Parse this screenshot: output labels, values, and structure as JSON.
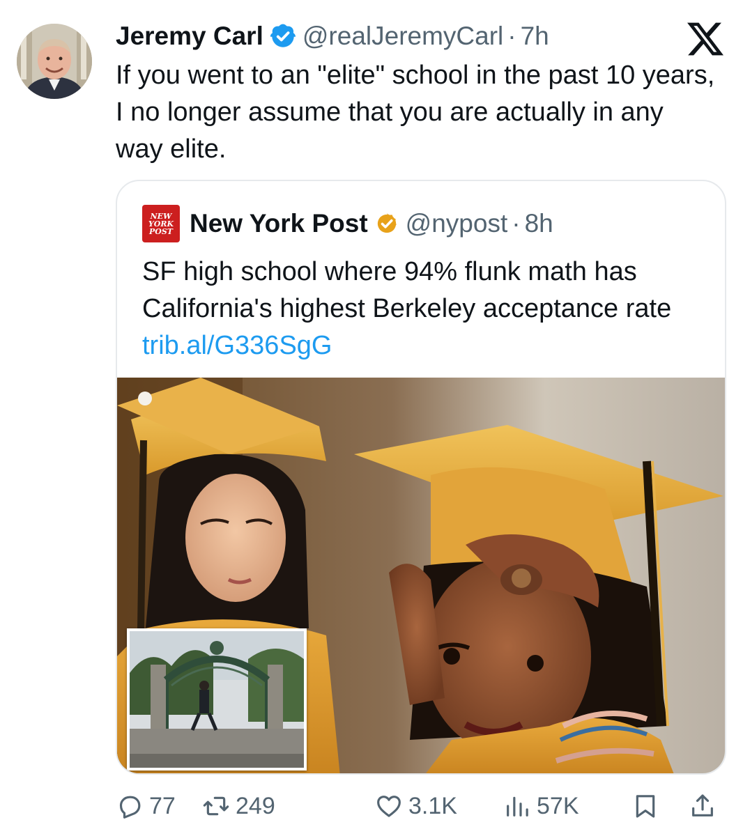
{
  "author": {
    "name": "Jeremy Carl",
    "handle": "@realJeremyCarl",
    "separator": "·",
    "time": "7h",
    "verified_color": "#1d9bf0"
  },
  "tweet": {
    "text": "If you went to an \"elite\" school in the past 10 years, I no longer assume that you are actually in any way elite."
  },
  "quoted": {
    "logo_lines": [
      "NEW",
      "YORK",
      "POST"
    ],
    "name": "New York Post",
    "handle": "@nypost",
    "separator": "·",
    "time": "8h",
    "text": "SF high school where 94% flunk math has California's highest Berkeley acceptance rate ",
    "link": "trib.al/G336SgG",
    "verified_color": "#e8a21a",
    "logo_color": "#cc1f1f"
  },
  "actions": {
    "replies": "77",
    "retweets": "249",
    "likes": "3.1K",
    "views": "57K"
  },
  "icons": [
    "x-logo-icon",
    "verified-badge-icon",
    "gold-check-icon",
    "reply-icon",
    "retweet-icon",
    "like-icon",
    "views-icon",
    "bookmark-icon",
    "share-icon"
  ],
  "colors": {
    "text": "#0f1419",
    "secondary": "#536471",
    "link": "#1d9bf0",
    "border": "#e6e9ec"
  }
}
